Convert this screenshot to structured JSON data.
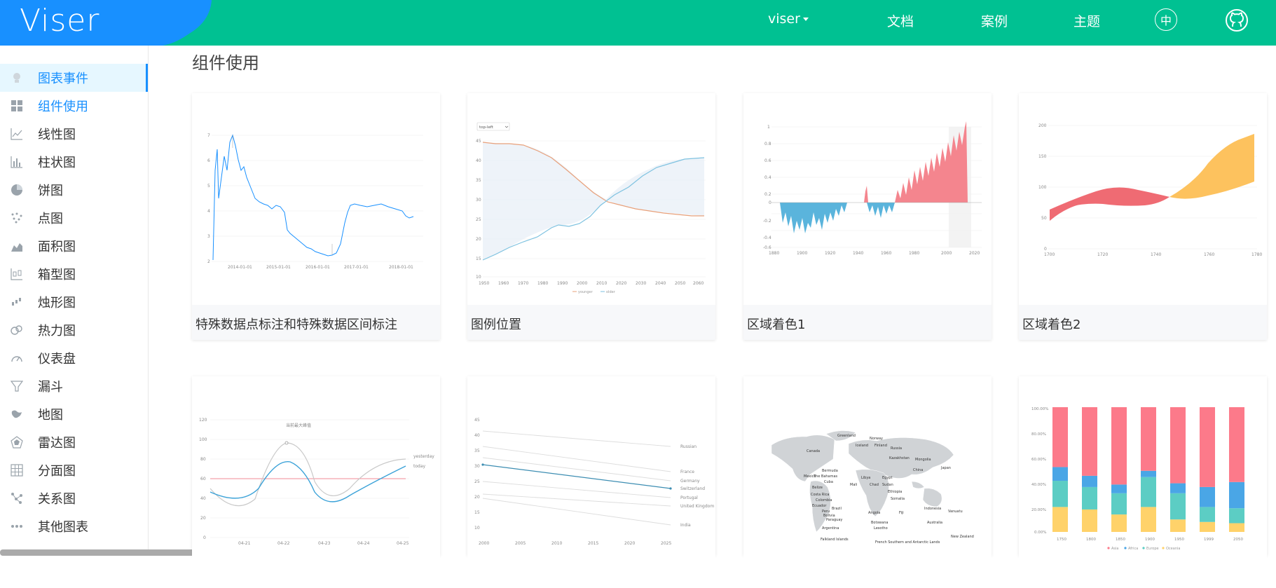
{
  "header": {
    "logo": "Viser",
    "nav": {
      "viser": "viser",
      "docs": "文档",
      "cases": "案例",
      "theme": "主题",
      "lang": "中"
    },
    "colors": {
      "brand": "#00c192",
      "logo_blue": "#1890ff"
    }
  },
  "sidebar": {
    "items": [
      {
        "label": "图表事件",
        "icon": "chart-event-icon"
      },
      {
        "label": "组件使用",
        "icon": "component-icon"
      },
      {
        "label": "线性图",
        "icon": "line-chart-icon"
      },
      {
        "label": "柱状图",
        "icon": "bar-chart-icon"
      },
      {
        "label": "饼图",
        "icon": "pie-chart-icon"
      },
      {
        "label": "点图",
        "icon": "point-chart-icon"
      },
      {
        "label": "面积图",
        "icon": "area-chart-icon"
      },
      {
        "label": "箱型图",
        "icon": "box-chart-icon"
      },
      {
        "label": "烛形图",
        "icon": "candle-chart-icon"
      },
      {
        "label": "热力图",
        "icon": "heat-map-icon"
      },
      {
        "label": "仪表盘",
        "icon": "gauge-icon"
      },
      {
        "label": "漏斗",
        "icon": "funnel-icon"
      },
      {
        "label": "地图",
        "icon": "map-icon"
      },
      {
        "label": "雷达图",
        "icon": "radar-chart-icon"
      },
      {
        "label": "分面图",
        "icon": "facet-chart-icon"
      },
      {
        "label": "关系图",
        "icon": "relation-chart-icon"
      },
      {
        "label": "其他图表",
        "icon": "more-icon"
      }
    ]
  },
  "main": {
    "title": "组件使用",
    "cards": [
      {
        "caption": "特殊数据点标注和特殊数据区间标注"
      },
      {
        "caption": "图例位置"
      },
      {
        "caption": "区域着色1"
      },
      {
        "caption": "区域着色2"
      },
      {
        "caption": ""
      },
      {
        "caption": ""
      },
      {
        "caption": ""
      },
      {
        "caption": ""
      }
    ]
  },
  "thumbs": {
    "c1": {
      "y_ticks": [
        "7",
        "6",
        "5",
        "4",
        "3",
        "2"
      ],
      "x_ticks": [
        "2014-01-01",
        "2015-01-01",
        "2016-01-01",
        "2017-01-01",
        "2018-01-01"
      ]
    },
    "c2": {
      "dropdown": "top-left",
      "y_ticks": [
        "45",
        "40",
        "35",
        "30",
        "25",
        "20",
        "15",
        "10"
      ],
      "x_ticks": [
        "1950",
        "1960",
        "1970",
        "1980",
        "1990",
        "2000",
        "2010",
        "2020",
        "2030",
        "2040",
        "2050",
        "2060"
      ],
      "legend": [
        "younger",
        "older"
      ]
    },
    "c3": {
      "y_ticks": [
        "1",
        "0.8",
        "0.6",
        "0.4",
        "0.2",
        "0",
        "-0.2",
        "-0.4",
        "-0.6"
      ],
      "x_ticks": [
        "1880",
        "1900",
        "1920",
        "1940",
        "1960",
        "1980",
        "2000",
        "2020"
      ]
    },
    "c4": {
      "y_ticks": [
        "200",
        "150",
        "100",
        "50",
        "0"
      ],
      "x_ticks": [
        "1700",
        "1720",
        "1740",
        "1760",
        "1780"
      ]
    },
    "c5": {
      "y_ticks": [
        "120",
        "100",
        "80",
        "60",
        "40",
        "20",
        "0"
      ],
      "x_ticks": [
        "04-21",
        "04-22",
        "04-23",
        "04-24",
        "04-25"
      ],
      "legend": [
        "yesterday",
        "today"
      ],
      "label_top": "当前最大峰值"
    },
    "c6": {
      "y_ticks": [
        "45",
        "40",
        "35",
        "30",
        "25",
        "20",
        "15",
        "10"
      ],
      "x_ticks": [
        "2000",
        "2005",
        "2010",
        "2015",
        "2020",
        "2025"
      ],
      "lines": [
        "Russian",
        "France",
        "Germany",
        "Switzerland",
        "Portugal",
        "United Kingdom",
        "India"
      ]
    },
    "c7": {
      "countries": [
        "Greenland",
        "Canada",
        "Norway",
        "Russia",
        "Iceland",
        "Finland",
        "Kazakhstan",
        "Mongolia",
        "China",
        "Japan",
        "Bermuda",
        "The Bahamas",
        "Cuba",
        "Mexico",
        "Belize",
        "Costa Rica",
        "Colombia",
        "Ecuador",
        "Peru",
        "Brazil",
        "Bolivia",
        "Paraguay",
        "Argentina",
        "Falkland Islands",
        "Libya",
        "Egypt",
        "Mali",
        "Chad",
        "Sudan",
        "Ethiopia",
        "Somalia",
        "Angola",
        "Botswana",
        "Lesotho",
        "Indonesia",
        "Australia",
        "Vanuatu",
        "Fiji",
        "New Zealand",
        "French Southern and Antarctic Lands"
      ]
    },
    "c8": {
      "y_ticks": [
        "100.00%",
        "80.00%",
        "60.00%",
        "40.00%",
        "20.00%",
        "0.00%"
      ],
      "x_ticks": [
        "1750",
        "1800",
        "1850",
        "1900",
        "1950",
        "1999",
        "2050"
      ],
      "legend": [
        "Asia",
        "Africa",
        "Europe",
        "Oceania"
      ]
    }
  }
}
